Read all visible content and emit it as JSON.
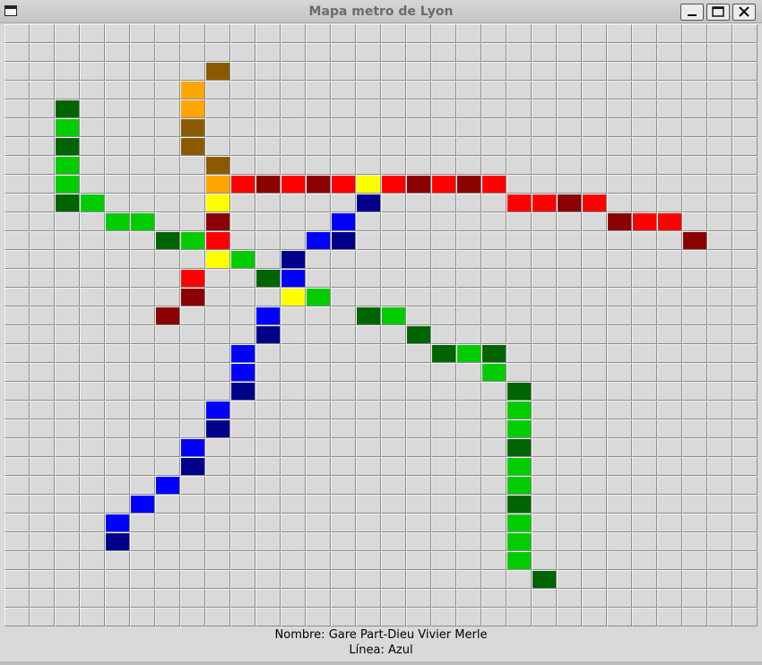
{
  "window": {
    "title": "Mapa metro de Lyon"
  },
  "grid": {
    "cols": 30,
    "rows": 32
  },
  "colors": {
    "R": "#ff0000",
    "r": "#8b0000",
    "B": "#0000ff",
    "b": "#00008b",
    "G": "#00cc00",
    "g": "#006400",
    "Y": "#ffff00",
    "O": "#ffa500",
    "o": "#8b5a00"
  },
  "map_rows": [
    "..............................",
    "..............................",
    "........o.....................",
    ".......O......................",
    "..g....O......................",
    "..G....o......................",
    "..g....o......................",
    "..G.....o.....................",
    "..G.....ORrRrRYRrRrR..........",
    "..gG....Y.....b.....RRrR......",
    "....GG..r....B..........rRR...",
    "......gGR...Bb.............r..",
    "........YG.b..................",
    ".......R..gB..................",
    ".......r...YG.................",
    "......r...B...gG..............",
    "..........b.....g.............",
    ".........B.......gGg..........",
    ".........B.........G..........",
    ".........b..........g.........",
    "........B...........G.........",
    "........b...........G.........",
    ".......B............g.........",
    ".......b............G.........",
    "......B.............G.........",
    ".....B..............g.........",
    "....B...............G.........",
    "....b...............G.........",
    "....................G.........",
    ".....................g........",
    "..............................",
    ".............................."
  ],
  "status": {
    "name_line": "Nombre: Gare Part-Dieu Vivier Merle",
    "line_line": "Línea: Azul"
  }
}
